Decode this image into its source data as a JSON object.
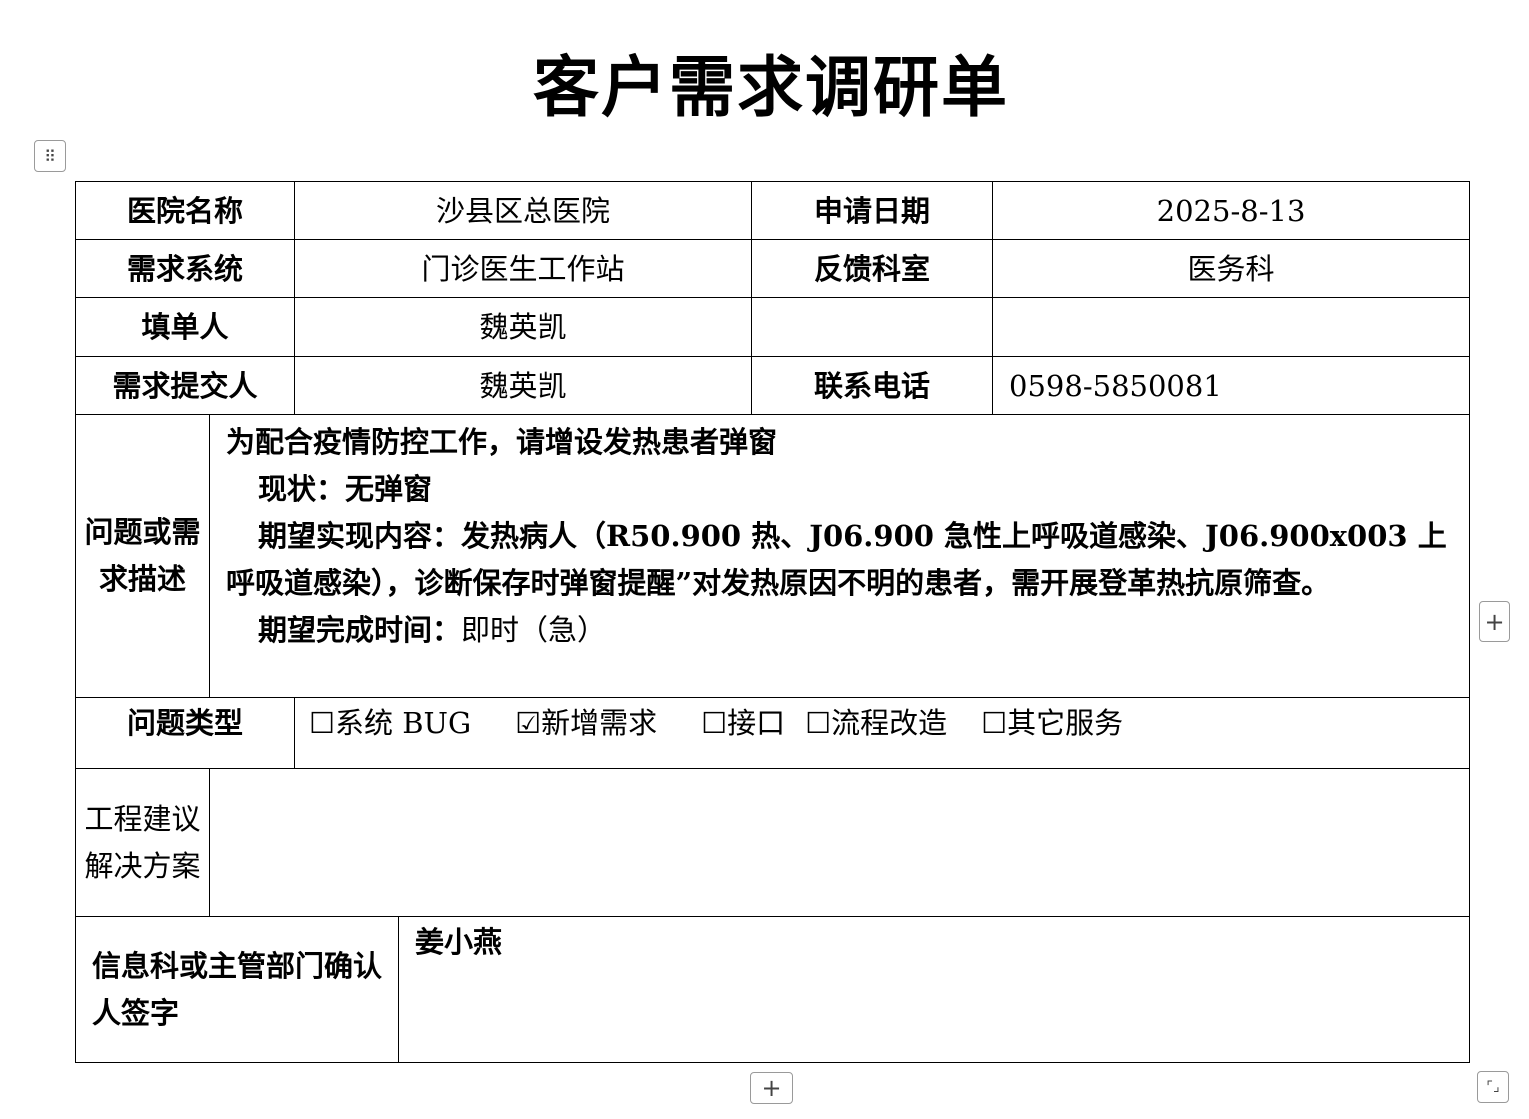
{
  "doc": {
    "title": "客户需求调研单"
  },
  "controls": {
    "drag_handle_glyph": "⠿",
    "add_column_glyph": "+",
    "add_row_glyph": "+",
    "resize_glyph": "⌜⌟"
  },
  "form": {
    "hospital_label": "医院名称",
    "hospital_value": "沙县区总医院",
    "apply_date_label": "申请日期",
    "apply_date_value": "2025-8-13",
    "system_label": "需求系统",
    "system_value": "门诊医生工作站",
    "dept_label": "反馈科室",
    "dept_value": "医务科",
    "filler_label": "填单人",
    "filler_value": "魏英凯",
    "submitter_label": "需求提交人",
    "submitter_value": "魏英凯",
    "phone_label": "联系电话",
    "phone_value": "0598-5850081",
    "problem_label": "问题或需求描述",
    "problem": {
      "line1": "为配合疫情防控工作，请增设发热患者弹窗",
      "line2": "现状：无弹窗",
      "line3_a": "期望实现内容：发热病人（",
      "line3_b": "R50.900",
      "line3_c": " 热、",
      "line3_d": "J06.900",
      "line3_e": " 急性上呼吸道感染、",
      "line3_f": "J06.900x003",
      "line3_g": " 上呼吸道感染），诊断保存时弹窗提醒”对发热原因不明的患者，需开展登革热抗原筛查。",
      "line4_label": "期望完成时间：",
      "line4_value": "即时（急）"
    },
    "type_label": "问题类型",
    "types": [
      {
        "label": "☐系统 BUG"
      },
      {
        "label": "☑新增需求"
      },
      {
        "label": "☐接口"
      },
      {
        "label": "☐流程改造"
      },
      {
        "label": "☐其它服务"
      }
    ],
    "solution_label": "工程建议解决方案",
    "solution_value": "",
    "confirm_label": "信息科或主管部门确认人签字",
    "confirm_value": "姜小燕"
  }
}
